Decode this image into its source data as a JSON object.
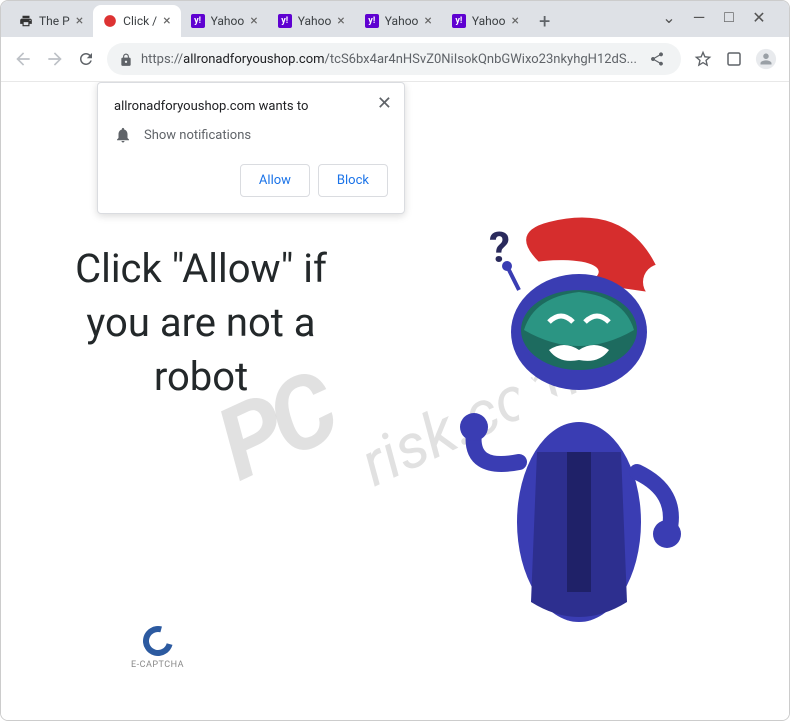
{
  "window": {
    "control_minimize": "—",
    "control_maximize": "□",
    "control_close": "✕",
    "control_dropdown": "⌄"
  },
  "tabs": [
    {
      "title": "The P",
      "has_favicon": true
    },
    {
      "title": "Click /",
      "has_favicon": true,
      "active": true
    },
    {
      "title": "Yahoo",
      "has_favicon": true
    },
    {
      "title": "Yahoo",
      "has_favicon": true
    },
    {
      "title": "Yahoo",
      "has_favicon": true
    },
    {
      "title": "Yahoo",
      "has_favicon": true
    }
  ],
  "toolbar": {
    "new_tab": "+"
  },
  "address": {
    "protocol": "https://",
    "domain": "allronadforyoushop.com",
    "path": "/tcS6bx4ar4nHSvZ0NiIsokQnbGWixo23nkyhgH12dS..."
  },
  "notification": {
    "header": "allronadforyoushop.com wants to",
    "body_text": "Show notifications",
    "allow_label": "Allow",
    "block_label": "Block",
    "close_symbol": "✕"
  },
  "page_content": {
    "main_text": "Click \"Allow\" if you are not a robot",
    "captcha_label": "E-CAPTCHA"
  },
  "watermark": {
    "line1": "PC",
    "line2": "risk.com"
  }
}
